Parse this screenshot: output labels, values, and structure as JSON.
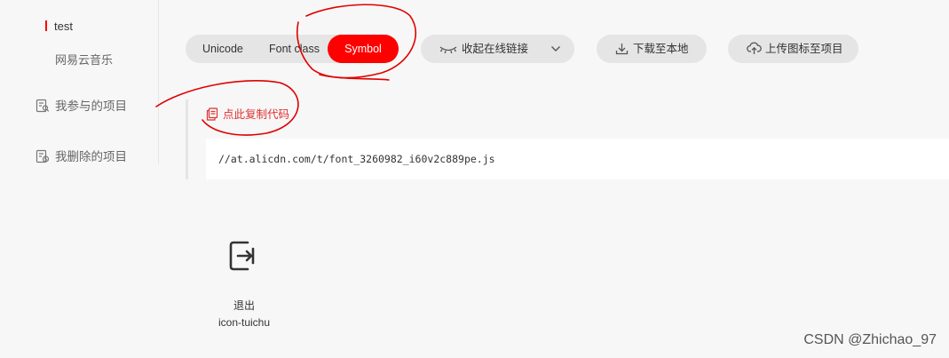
{
  "sidebar": {
    "active_project": "test",
    "sub_project": "网易云音乐",
    "participating_label": "我参与的项目",
    "deleted_label": "我删除的项目"
  },
  "tabs": {
    "unicode": "Unicode",
    "font_class": "Font class",
    "symbol": "Symbol",
    "selected": "Symbol"
  },
  "toolbar": {
    "collapse_label": "收起在线链接",
    "download_label": "下载至本地",
    "upload_label": "上传图标至项目"
  },
  "code_panel": {
    "copy_label": "点此复制代码",
    "code": "//at.alicdn.com/t/font_3260982_i60v2c889pe.js"
  },
  "icon": {
    "icon_type": "exit-icon",
    "name": "退出",
    "code": "icon-tuichu"
  },
  "watermark": "CSDN @Zhichao_97",
  "colors": {
    "accent": "#ff0000",
    "background": "#f7f7f7",
    "pill": "#e5e5e5",
    "annotation": "#e00000"
  }
}
